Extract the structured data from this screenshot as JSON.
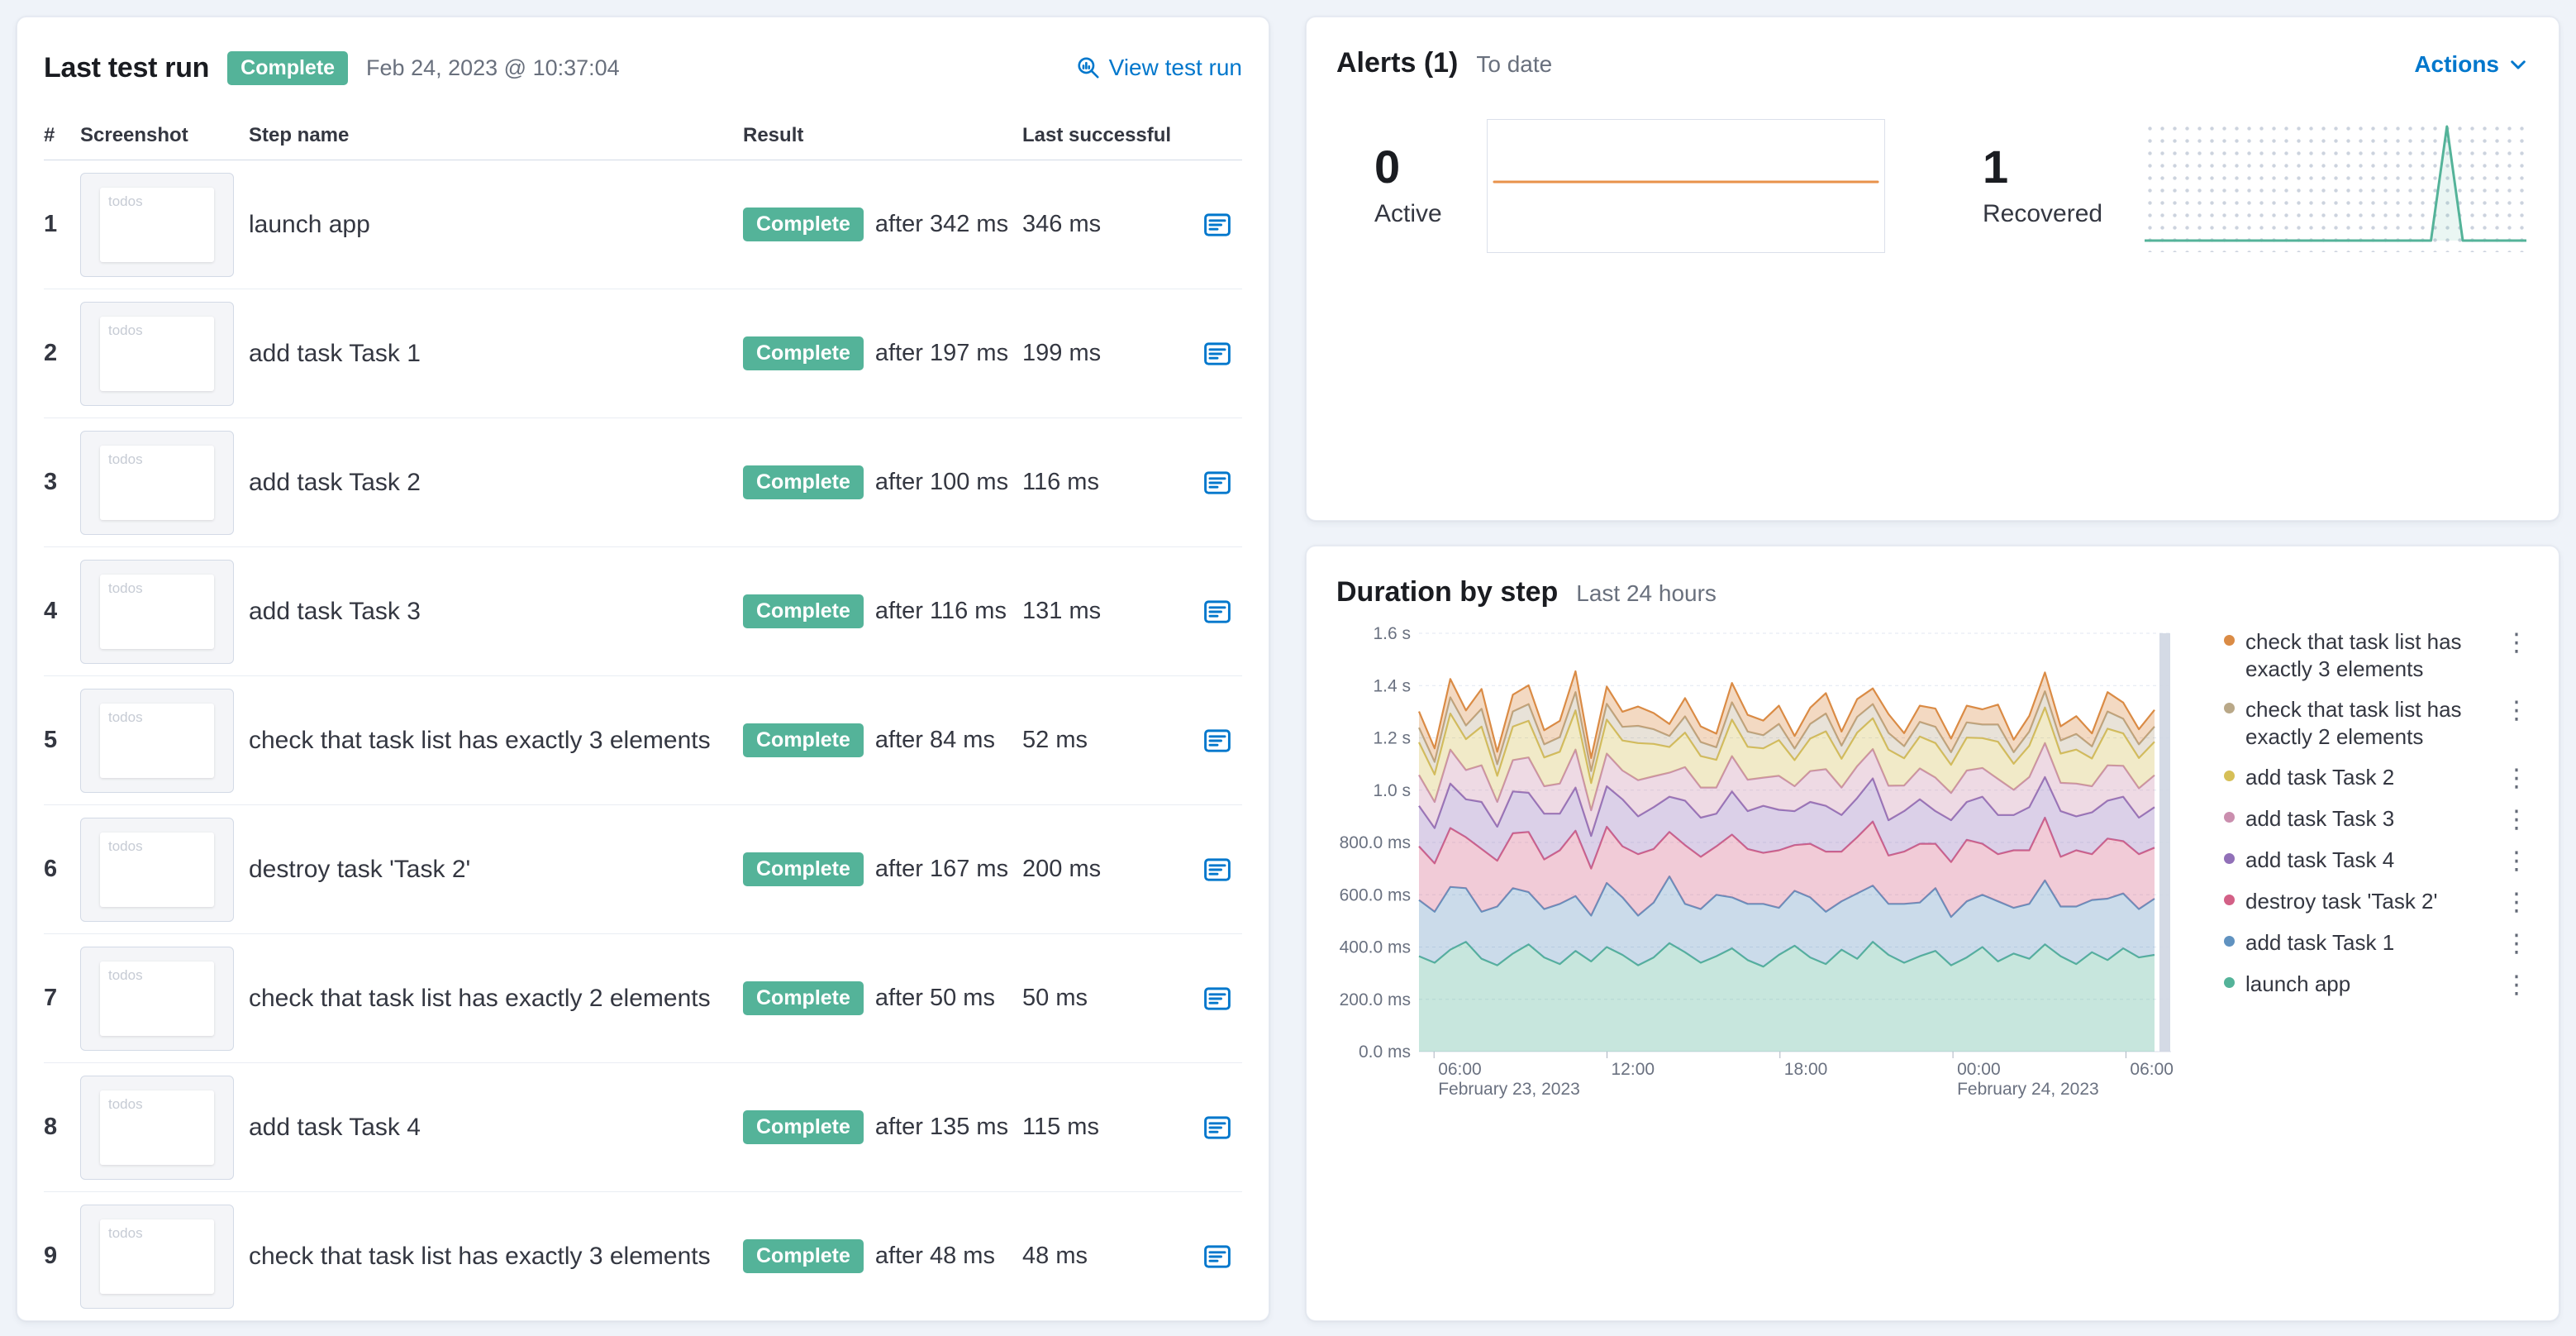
{
  "colors": {
    "page_bg": "#EFF3F9",
    "link_accent": "#0077CC",
    "badge_success_bg": "#54B399",
    "text_primary": "#343741",
    "text_subdued": "#69707D"
  },
  "icons": {
    "kebab": "⋮"
  },
  "last_test_run": {
    "title": "Last test run",
    "status_badge": "Complete",
    "timestamp": "Feb 24, 2023 @ 10:37:04",
    "view_test_run": "View test run",
    "table": {
      "headers": {
        "num": "#",
        "screenshot": "Screenshot",
        "step_name": "Step name",
        "result": "Result",
        "last_successful": "Last successful"
      },
      "thumb_label": "todos",
      "rows": [
        {
          "num": "1",
          "step": "launch app",
          "badge": "Complete",
          "after": "after 342 ms",
          "last_successful": "346 ms"
        },
        {
          "num": "2",
          "step": "add task Task 1",
          "badge": "Complete",
          "after": "after 197 ms",
          "last_successful": "199 ms"
        },
        {
          "num": "3",
          "step": "add task Task 2",
          "badge": "Complete",
          "after": "after 100 ms",
          "last_successful": "116 ms"
        },
        {
          "num": "4",
          "step": "add task Task 3",
          "badge": "Complete",
          "after": "after 116 ms",
          "last_successful": "131 ms"
        },
        {
          "num": "5",
          "step": "check that task list has exactly 3 elements",
          "badge": "Complete",
          "after": "after 84 ms",
          "last_successful": "52 ms"
        },
        {
          "num": "6",
          "step": "destroy task 'Task 2'",
          "badge": "Complete",
          "after": "after 167 ms",
          "last_successful": "200 ms"
        },
        {
          "num": "7",
          "step": "check that task list has exactly 2 elements",
          "badge": "Complete",
          "after": "after 50 ms",
          "last_successful": "50 ms"
        },
        {
          "num": "8",
          "step": "add task Task 4",
          "badge": "Complete",
          "after": "after 135 ms",
          "last_successful": "115 ms"
        },
        {
          "num": "9",
          "step": "check that task list has exactly 3 elements",
          "badge": "Complete",
          "after": "after 48 ms",
          "last_successful": "48 ms"
        }
      ]
    }
  },
  "alerts": {
    "title": "Alerts (1)",
    "subtitle": "To date",
    "actions": "Actions",
    "active": {
      "value": "0",
      "label": "Active",
      "color": "#E8924A"
    },
    "recovered": {
      "value": "1",
      "label": "Recovered",
      "color": "#54B399"
    }
  },
  "duration": {
    "title": "Duration by step",
    "subtitle": "Last 24 hours",
    "legend": [
      {
        "label": "check that task list has exactly 3 elements",
        "color": "#DA8B45"
      },
      {
        "label": "check that task list has exactly 2 elements",
        "color": "#B9A888"
      },
      {
        "label": "add task Task 2",
        "color": "#D6BF57"
      },
      {
        "label": "add task Task 3",
        "color": "#CA8EAE"
      },
      {
        "label": "add task Task 4",
        "color": "#9170B8"
      },
      {
        "label": "destroy task 'Task 2'",
        "color": "#D36086"
      },
      {
        "label": "add task Task 1",
        "color": "#6092C0"
      },
      {
        "label": "launch app",
        "color": "#54B399"
      }
    ]
  },
  "chart_data": [
    {
      "id": "alerts-active-spark",
      "type": "line",
      "title": "Active alerts sparkline",
      "color": "#E8924A",
      "values": [
        0,
        0,
        0,
        0,
        0,
        0,
        0,
        0,
        0,
        0,
        0,
        0,
        0,
        0,
        0,
        0,
        0,
        0,
        0,
        0,
        0,
        0,
        0,
        0,
        0
      ],
      "ylim": [
        0,
        1
      ]
    },
    {
      "id": "alerts-recovered-spark",
      "type": "line",
      "title": "Recovered alerts sparkline",
      "color": "#54B399",
      "values": [
        0,
        0,
        0,
        0,
        0,
        0,
        0,
        0,
        0,
        0,
        0,
        0,
        0,
        0,
        0,
        0,
        0,
        0,
        0,
        1,
        0,
        0,
        0,
        0,
        0
      ],
      "ylim": [
        0,
        1
      ]
    },
    {
      "id": "duration-by-step",
      "type": "area",
      "stacked": true,
      "title": "Duration by step",
      "subtitle": "Last 24 hours",
      "ylim_ms": [
        0,
        1600
      ],
      "y_ticks": [
        {
          "value": 0,
          "label": "0.0 ms"
        },
        {
          "value": 200,
          "label": "200.0 ms"
        },
        {
          "value": 400,
          "label": "400.0 ms"
        },
        {
          "value": 600,
          "label": "600.0 ms"
        },
        {
          "value": 800,
          "label": "800.0 ms"
        },
        {
          "value": 1000,
          "label": "1.0 s"
        },
        {
          "value": 1200,
          "label": "1.2 s"
        },
        {
          "value": 1400,
          "label": "1.4 s"
        },
        {
          "value": 1600,
          "label": "1.6 s"
        }
      ],
      "x_ticks": [
        {
          "label": "06:00",
          "frac": 0.02
        },
        {
          "label": "12:00",
          "frac": 0.25
        },
        {
          "label": "18:00",
          "frac": 0.48
        },
        {
          "label": "00:00",
          "frac": 0.71
        },
        {
          "label": "06:00",
          "frac": 0.94
        }
      ],
      "date_labels": [
        {
          "label": "February 23, 2023",
          "frac": 0.02
        },
        {
          "label": "February 24, 2023",
          "frac": 0.71
        }
      ],
      "series": [
        {
          "name": "launch app",
          "color": "#54B399",
          "values": [
            365,
            340,
            390,
            420,
            355,
            330,
            375,
            410,
            360,
            335,
            385,
            345,
            400,
            370,
            330,
            360,
            415,
            380,
            340,
            365,
            395,
            350,
            325,
            370,
            405,
            360,
            335,
            390,
            355,
            420,
            370,
            340,
            365,
            385,
            330,
            360,
            400,
            345,
            375,
            355,
            410,
            365,
            335,
            380,
            350,
            395,
            360,
            370
          ]
        },
        {
          "name": "add task Task 1",
          "color": "#6092C0",
          "values": [
            215,
            195,
            240,
            205,
            180,
            225,
            250,
            200,
            185,
            230,
            210,
            175,
            245,
            220,
            190,
            210,
            255,
            185,
            205,
            235,
            195,
            215,
            240,
            180,
            210,
            230,
            200,
            185,
            250,
            215,
            195,
            225,
            205,
            240,
            185,
            215,
            200,
            230,
            175,
            210,
            245,
            190,
            220,
            200,
            235,
            210,
            185,
            215
          ]
        },
        {
          "name": "destroy task 'Task 2'",
          "color": "#D36086",
          "values": [
            205,
            185,
            225,
            195,
            240,
            175,
            210,
            230,
            190,
            205,
            250,
            180,
            215,
            195,
            235,
            205,
            170,
            225,
            200,
            185,
            240,
            210,
            195,
            220,
            175,
            205,
            230,
            190,
            215,
            245,
            185,
            200,
            225,
            170,
            210,
            235,
            195,
            180,
            220,
            205,
            240,
            190,
            215,
            175,
            230,
            200,
            210,
            195
          ]
        },
        {
          "name": "add task Task 4",
          "color": "#9170B8",
          "values": [
            155,
            135,
            170,
            145,
            180,
            130,
            160,
            150,
            175,
            140,
            165,
            125,
            155,
            180,
            145,
            160,
            135,
            170,
            150,
            125,
            165,
            145,
            180,
            155,
            130,
            160,
            175,
            140,
            150,
            165,
            135,
            155,
            170,
            125,
            160,
            145,
            180,
            150,
            135,
            165,
            155,
            175,
            130,
            160,
            145,
            170,
            140,
            155
          ]
        },
        {
          "name": "add task Task 3",
          "color": "#CA8EAE",
          "values": [
            118,
            100,
            130,
            112,
            140,
            95,
            120,
            135,
            105,
            115,
            145,
            98,
            125,
            110,
            138,
            118,
            92,
            128,
            115,
            100,
            135,
            120,
            108,
            130,
            95,
            118,
            140,
            105,
            122,
            112,
            132,
            98,
            118,
            128,
            104,
            120,
            110,
            138,
            96,
            115,
            130,
            108,
            125,
            100,
            135,
            118,
            112,
            122
          ]
        },
        {
          "name": "add task Task 2",
          "color": "#D6BF57",
          "values": [
            125,
            105,
            138,
            118,
            148,
            100,
            128,
            140,
            110,
            122,
            150,
            104,
            130,
            115,
            142,
            124,
            98,
            132,
            120,
            106,
            140,
            126,
            112,
            136,
            100,
            124,
            145,
            110,
            128,
            118,
            138,
            104,
            122,
            132,
            108,
            126,
            114,
            142,
            100,
            120,
            136,
            112,
            130,
            106,
            140,
            124,
            116,
            128
          ]
        },
        {
          "name": "check that task list has exactly 2 elements",
          "color": "#B9A888",
          "values": [
            56,
            48,
            62,
            52,
            68,
            44,
            58,
            64,
            50,
            56,
            70,
            46,
            60,
            52,
            66,
            56,
            42,
            62,
            54,
            48,
            66,
            58,
            50,
            62,
            44,
            56,
            68,
            50,
            60,
            54,
            64,
            46,
            56,
            62,
            48,
            58,
            52,
            66,
            44,
            54,
            62,
            50,
            60,
            46,
            66,
            56,
            52,
            58
          ]
        },
        {
          "name": "check that task list has exactly 3 elements",
          "color": "#DA8B45",
          "values": [
            62,
            52,
            70,
            58,
            76,
            48,
            64,
            72,
            54,
            62,
            80,
            50,
            66,
            58,
            74,
            62,
            46,
            70,
            60,
            52,
            74,
            64,
            56,
            70,
            48,
            62,
            78,
            54,
            68,
            60,
            72,
            50,
            62,
            70,
            52,
            64,
            58,
            76,
            48,
            60,
            72,
            54,
            68,
            50,
            74,
            62,
            58,
            64
          ]
        }
      ]
    }
  ]
}
